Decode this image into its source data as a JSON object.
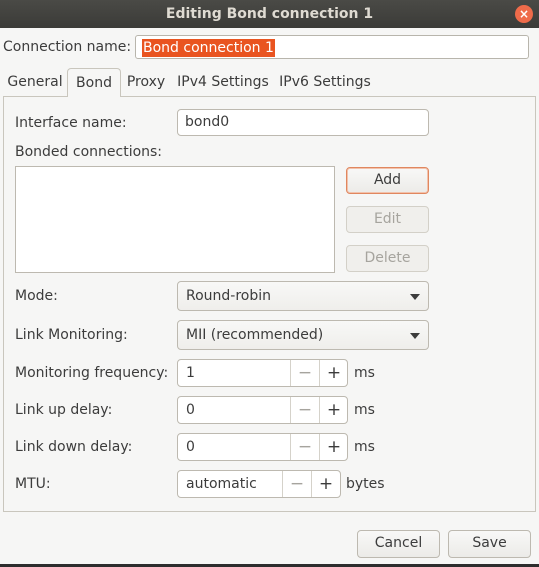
{
  "window": {
    "title": "Editing Bond connection 1",
    "close_glyph": "×"
  },
  "connection": {
    "label": "Connection name:",
    "value": "Bond connection 1"
  },
  "tabs": [
    {
      "label": "General"
    },
    {
      "label": "Bond",
      "active": true
    },
    {
      "label": "Proxy"
    },
    {
      "label": "IPv4 Settings"
    },
    {
      "label": "IPv6 Settings"
    }
  ],
  "bond": {
    "interface_label": "Interface name:",
    "interface_value": "bond0",
    "bonded_label": "Bonded connections:",
    "add_label": "Add",
    "edit_label": "Edit",
    "delete_label": "Delete",
    "mode_label": "Mode:",
    "mode_value": "Round-robin",
    "link_monitoring_label": "Link Monitoring:",
    "link_monitoring_value": "MII (recommended)",
    "monitoring_frequency_label": "Monitoring frequency:",
    "monitoring_frequency_value": "1",
    "monitoring_frequency_unit": "ms",
    "link_up_label": "Link up delay:",
    "link_up_value": "0",
    "link_up_unit": "ms",
    "link_down_label": "Link down delay:",
    "link_down_value": "0",
    "link_down_unit": "ms",
    "mtu_label": "MTU:",
    "mtu_value": "automatic",
    "mtu_unit": "bytes",
    "minus_glyph": "−",
    "plus_glyph": "+"
  },
  "footer": {
    "cancel_label": "Cancel",
    "save_label": "Save"
  },
  "colors": {
    "accent": "#e95420",
    "titlebar": "#3b3b38",
    "background": "#f6f6f5"
  }
}
